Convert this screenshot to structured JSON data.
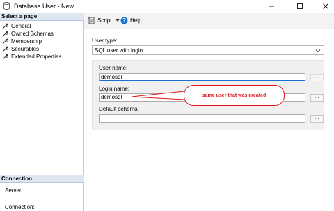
{
  "window": {
    "title": "Database User - New"
  },
  "left_pane": {
    "select_page_header": "Select a page",
    "pages": [
      {
        "label": "General"
      },
      {
        "label": "Owned Schemas"
      },
      {
        "label": "Membership"
      },
      {
        "label": "Securables"
      },
      {
        "label": "Extended Properties"
      }
    ],
    "connection_header": "Connection",
    "server_label": "Server:",
    "connection_label": "Connection:"
  },
  "toolbar": {
    "script_label": "Script",
    "help_label": "Help"
  },
  "form": {
    "user_type_label": "User type:",
    "user_type_value": "SQL user with login",
    "user_name_label": "User name:",
    "user_name_value": "demosql",
    "login_name_label": "Login name:",
    "login_name_value": "demosql",
    "default_schema_label": "Default schema:",
    "default_schema_value": "",
    "browse_label": "..."
  },
  "annotation": {
    "text": "same user that was created",
    "color": "#e0141a"
  },
  "colors": {
    "section_header_bg": "#dde6f2",
    "focus_accent": "#1a6fd1"
  }
}
